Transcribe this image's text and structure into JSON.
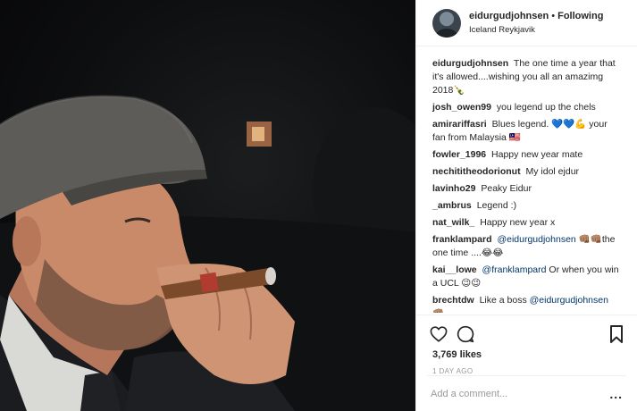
{
  "header": {
    "username": "eidurgudjohnsen",
    "separator": "•",
    "follow_status": "Following",
    "location": "Iceland Reykjavik"
  },
  "caption": {
    "user": "eidurgudjohnsen",
    "text": "The one time a year that it's allowed....wishing you all an amazimg 2018🍾"
  },
  "comments": [
    {
      "user": "josh_owen99",
      "text": "you legend up the chels"
    },
    {
      "user": "amirariffasri",
      "text": "Blues legend. 💙💙💪 your fan from Malaysia 🇲🇾"
    },
    {
      "user": "fowler_1996",
      "text": "Happy new year mate"
    },
    {
      "user": "nechititheodorionut",
      "text": "My idol ejdur"
    },
    {
      "user": "lavinho29",
      "text": "Peaky Eidur"
    },
    {
      "user": "_ambrus",
      "text": "Legend :)"
    },
    {
      "user": "nat_wilk_",
      "text": "Happy new year x"
    },
    {
      "user": "franklampard",
      "mention": "@eidurgudjohnsen",
      "text": "👊🏽👊🏽the one time ....😂😂"
    },
    {
      "user": "kai__lowe",
      "mention": "@franklampard",
      "text": "Or when you win a UCL 😉😉"
    },
    {
      "user": "brechtdw",
      "text": "Like a boss",
      "mention": "@eidurgudjohnsen",
      "suffix": "👊🏽"
    }
  ],
  "actions": {
    "icons": [
      "heart-icon",
      "comment-icon",
      "bookmark-icon"
    ]
  },
  "likes": "3,769 likes",
  "time": "1 DAY AGO",
  "comment_box": {
    "placeholder": "Add a comment...",
    "more": "..."
  }
}
